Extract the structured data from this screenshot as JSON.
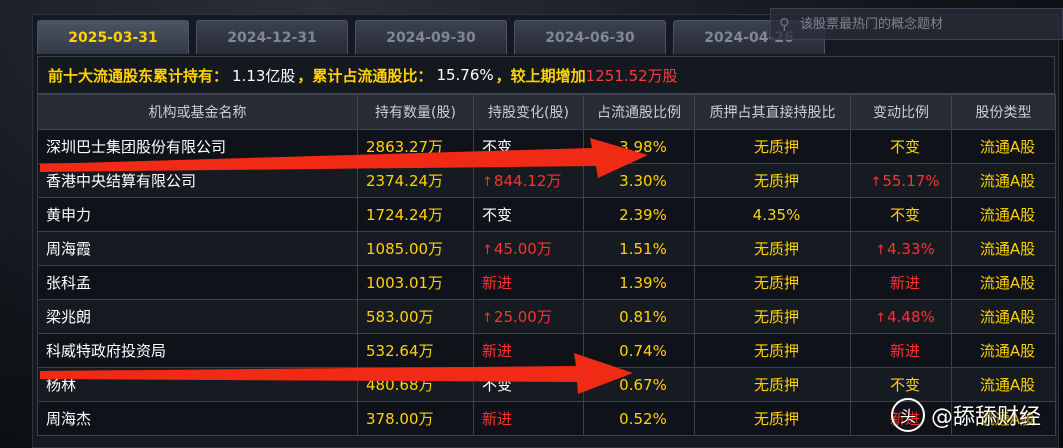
{
  "tabs": [
    {
      "label": "2025-03-31",
      "active": true
    },
    {
      "label": "2024-12-31",
      "active": false
    },
    {
      "label": "2024-09-30",
      "active": false
    },
    {
      "label": "2024-06-30",
      "active": false
    },
    {
      "label": "2024-04-26",
      "active": false
    }
  ],
  "search": {
    "placeholder": "该股票最热门的概念题材"
  },
  "summary": {
    "label1": "前十大流通股东累计持有：",
    "value1": "1.13亿股",
    "label2": "，累计占流通股比：",
    "value2": "15.76%",
    "label3": "，较上期增加",
    "value3": "1251.52万股"
  },
  "table": {
    "headers": [
      "机构或基金名称",
      "持有数量(股)",
      "持股变化(股)",
      "占流通股比例",
      "质押占其直接持股比",
      "变动比例",
      "股份类型"
    ],
    "rows": [
      {
        "name": "深圳巴士集团股份有限公司",
        "qty": "2863.27万",
        "change": "不变",
        "change_type": "same",
        "pct": "3.98%",
        "pledge": "无质押",
        "ratio": "不变",
        "ratio_type": "same",
        "stype": "流通A股"
      },
      {
        "name": "香港中央结算有限公司",
        "qty": "2374.24万",
        "change": "844.12万",
        "change_type": "up",
        "pct": "3.30%",
        "pledge": "无质押",
        "ratio": "55.17%",
        "ratio_type": "up",
        "stype": "流通A股"
      },
      {
        "name": "黄申力",
        "qty": "1724.24万",
        "change": "不变",
        "change_type": "same",
        "pct": "2.39%",
        "pledge": "4.35%",
        "ratio": "不变",
        "ratio_type": "same",
        "stype": "流通A股"
      },
      {
        "name": "周海霞",
        "qty": "1085.00万",
        "change": "45.00万",
        "change_type": "up",
        "pct": "1.51%",
        "pledge": "无质押",
        "ratio": "4.33%",
        "ratio_type": "up",
        "stype": "流通A股"
      },
      {
        "name": "张科孟",
        "qty": "1003.01万",
        "change": "新进",
        "change_type": "new",
        "pct": "1.39%",
        "pledge": "无质押",
        "ratio": "新进",
        "ratio_type": "new",
        "stype": "流通A股"
      },
      {
        "name": "梁兆朗",
        "qty": "583.00万",
        "change": "25.00万",
        "change_type": "up",
        "pct": "0.81%",
        "pledge": "无质押",
        "ratio": "4.48%",
        "ratio_type": "up",
        "stype": "流通A股"
      },
      {
        "name": "科威特政府投资局",
        "qty": "532.64万",
        "change": "新进",
        "change_type": "new",
        "pct": "0.74%",
        "pledge": "无质押",
        "ratio": "新进",
        "ratio_type": "new",
        "stype": "流通A股"
      },
      {
        "name": "杨林",
        "qty": "480.68万",
        "change": "不变",
        "change_type": "same",
        "pct": "0.67%",
        "pledge": "无质押",
        "ratio": "不变",
        "ratio_type": "same",
        "stype": "流通A股"
      },
      {
        "name": "周海杰",
        "qty": "378.00万",
        "change": "新进",
        "change_type": "new",
        "pct": "0.52%",
        "pledge": "无质押",
        "ratio": "新进",
        "ratio_type": "new",
        "stype": "流通A股"
      }
    ]
  },
  "watermark": {
    "logo": "头",
    "text": "@舔舔财经"
  },
  "colors": {
    "accent": "#ffd200",
    "up": "#ff3131",
    "arrow": "#f02a14"
  },
  "icons": {
    "search": "search-icon",
    "up_arrow": "up-arrow-icon"
  }
}
